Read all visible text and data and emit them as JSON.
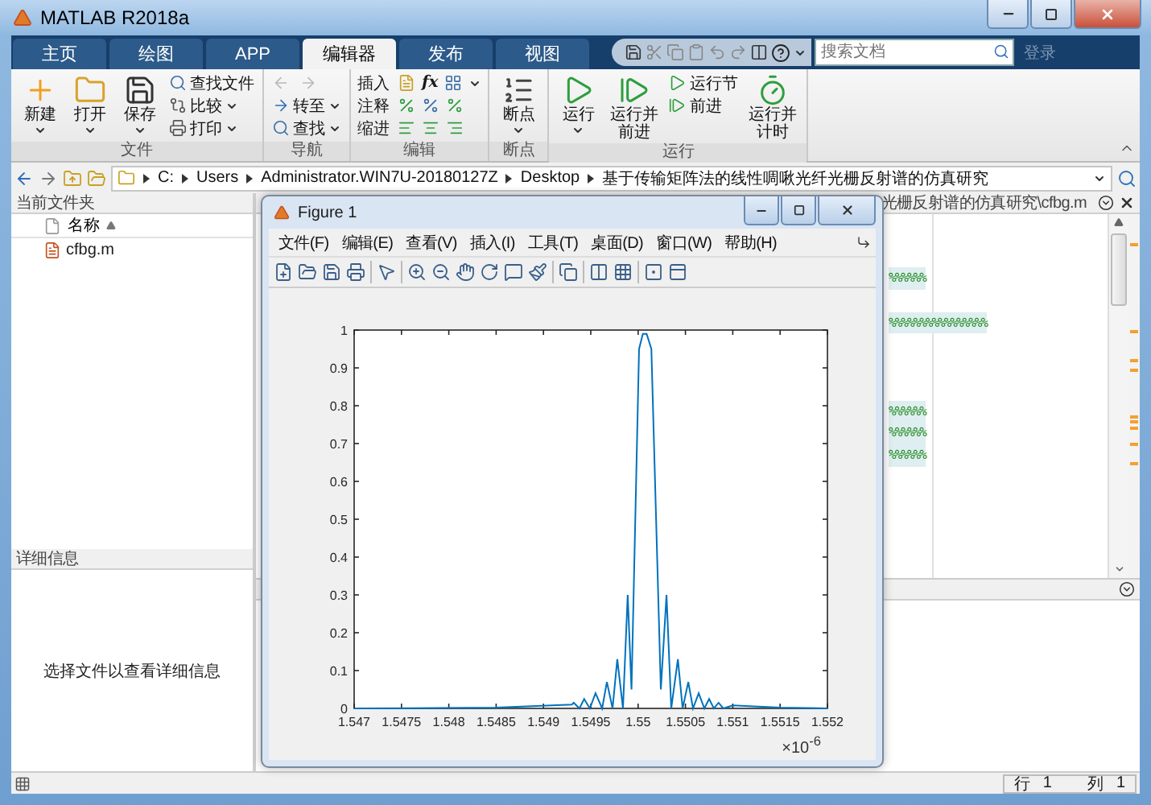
{
  "window": {
    "title": "MATLAB R2018a"
  },
  "tabs": [
    {
      "label": "主页",
      "selected": false
    },
    {
      "label": "绘图",
      "selected": false
    },
    {
      "label": "APP",
      "selected": false
    },
    {
      "label": "编辑器",
      "selected": true
    },
    {
      "label": "发布",
      "selected": false
    },
    {
      "label": "视图",
      "selected": false
    }
  ],
  "search": {
    "placeholder": "搜索文档"
  },
  "sign_in": {
    "label": "登录",
    "disabled": true
  },
  "ribbon": {
    "groups": [
      {
        "title": "文件",
        "items": [
          {
            "kind": "large",
            "label": "新建",
            "has_menu": true
          },
          {
            "kind": "large",
            "label": "打开",
            "has_menu": true
          },
          {
            "kind": "large",
            "label": "保存",
            "has_menu": true
          },
          {
            "kind": "small",
            "label": "查找文件",
            "has_menu": false
          },
          {
            "kind": "small",
            "label": "比较",
            "has_menu": true
          },
          {
            "kind": "small",
            "label": "打印",
            "has_menu": true
          }
        ]
      },
      {
        "title": "导航",
        "items": [
          {
            "kind": "arrows",
            "disabled": true
          },
          {
            "kind": "small",
            "label": "转至",
            "has_menu": true
          },
          {
            "kind": "small",
            "label": "查找",
            "has_menu": true
          }
        ]
      },
      {
        "title": "编辑",
        "items": [
          {
            "kind": "row",
            "label": "插入",
            "symbol": "fx",
            "has_menu": true
          },
          {
            "kind": "row",
            "label": "注释",
            "has_menu": false
          },
          {
            "kind": "row",
            "label": "缩进",
            "has_menu": false
          }
        ]
      },
      {
        "title": "断点",
        "items": [
          {
            "kind": "large",
            "label": "断点",
            "has_menu": true
          }
        ]
      },
      {
        "title": "运行",
        "items": [
          {
            "kind": "large",
            "label": "运行",
            "has_menu": true
          },
          {
            "kind": "large",
            "label": "运行并前进",
            "has_menu": false
          },
          {
            "kind": "small",
            "label": "运行节",
            "has_menu": false
          },
          {
            "kind": "small",
            "label": "前进",
            "has_menu": false
          },
          {
            "kind": "large",
            "label": "运行并计时",
            "has_menu": false
          }
        ]
      }
    ]
  },
  "address": {
    "segments": [
      "C:",
      "Users",
      "Administrator.WIN7U-20180127Z",
      "Desktop",
      "基于传输矩阵法的线性啁啾光纤光栅反射谱的仿真研究"
    ]
  },
  "current_folder": {
    "title": "当前文件夹",
    "column": "名称",
    "sort_ascending": true,
    "files": [
      "cfbg.m"
    ]
  },
  "details": {
    "title": "详细信息",
    "message": "选择文件以查看详细信息"
  },
  "editor": {
    "tab_title": "光栅反射谱的仿真研究\\cfbg.m",
    "code_lines": [
      "%%%%%%",
      "%%%%%%%%%%%%%%%%",
      "%%%%%%",
      "%%%%%%",
      "%%%%%%"
    ]
  },
  "status_bar": {
    "row_label": "行",
    "row": "1",
    "col_label": "列",
    "col": "1"
  },
  "figure": {
    "title": "Figure 1",
    "menu": [
      "文件(F)",
      "编辑(E)",
      "查看(V)",
      "插入(I)",
      "工具(T)",
      "桌面(D)",
      "窗口(W)",
      "帮助(H)"
    ],
    "chart_data": {
      "type": "line",
      "xlim": [
        1.547,
        1.552
      ],
      "ylim": [
        0,
        1
      ],
      "xticks": [
        1.547,
        1.5475,
        1.548,
        1.5485,
        1.549,
        1.5495,
        1.55,
        1.5505,
        1.551,
        1.5515,
        1.552
      ],
      "yticks": [
        0,
        0.1,
        0.2,
        0.3,
        0.4,
        0.5,
        0.6,
        0.7,
        0.8,
        0.9,
        1
      ],
      "annotations": [
        {
          "text": "×10$^{-6}$"
        }
      ],
      "x": [
        1.547,
        1.5485,
        1.5493,
        1.54932,
        1.54938,
        1.54943,
        1.54949,
        1.54955,
        1.54962,
        1.54967,
        1.54973,
        1.54978,
        1.54984,
        1.54989,
        1.54993,
        1.54997,
        1.55001,
        1.55005,
        1.55009,
        1.55014,
        1.55019,
        1.55024,
        1.5503,
        1.55035,
        1.55042,
        1.55047,
        1.55053,
        1.55058,
        1.55064,
        1.5507,
        1.55075,
        1.5508,
        1.55085,
        1.5509,
        1.551,
        1.5515,
        1.552
      ],
      "series": [
        {
          "color": "#0072bd",
          "values": [
            0,
            0.002,
            0.01,
            0.015,
            0,
            0.025,
            0,
            0.04,
            0,
            0.07,
            0,
            0.13,
            0,
            0.3,
            0.05,
            0.5,
            0.95,
            0.99,
            0.99,
            0.95,
            0.5,
            0.05,
            0.3,
            0,
            0.13,
            0,
            0.07,
            0,
            0.04,
            0,
            0.025,
            0,
            0.015,
            0,
            0.008,
            0.002,
            0
          ]
        }
      ]
    }
  }
}
